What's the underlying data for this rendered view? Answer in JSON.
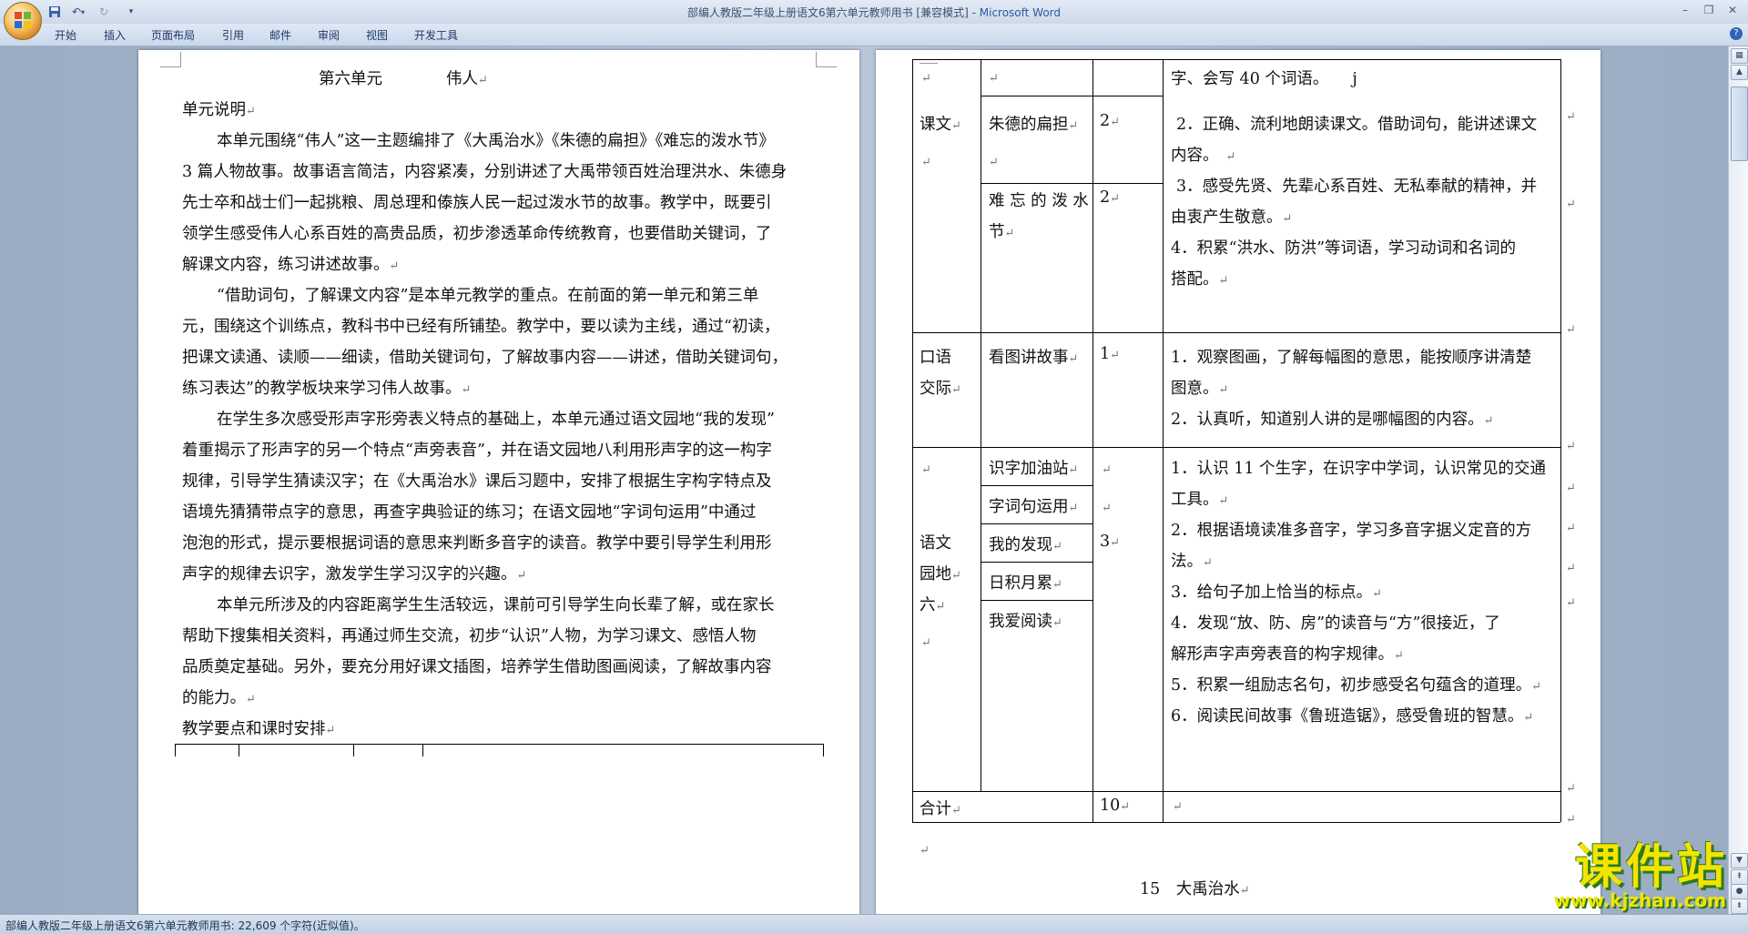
{
  "window": {
    "title_main": "部编人教版二年级上册语文6第六单元教师用书 [兼容模式] - ",
    "title_app": "Microsoft Word"
  },
  "ribbon": {
    "tabs": [
      "开始",
      "插入",
      "页面布局",
      "引用",
      "邮件",
      "审阅",
      "视图",
      "开发工具"
    ]
  },
  "left_page": {
    "heading_unit": "第六单元",
    "heading_theme": "伟人",
    "lines": [
      "单元说明",
      "本单元围绕“伟人”这一主题编排了《大禹治水》《朱德的扁担》《难忘的泼水节》",
      "3 篇人物故事。故事语言简洁，内容紧凑，分别讲述了大禹带领百姓治理洪水、朱德身",
      "先士卒和战士们一起挑粮、周总理和傣族人民一起过泼水节的故事。教学中，既要引",
      "领学生感受伟人心系百姓的高贵品质，初步渗透革命传统教育，也要借助关键词，了",
      "解课文内容，练习讲述故事。",
      "“借助词句，了解课文内容”是本单元教学的重点。在前面的第一单元和第三单",
      "元，围绕这个训练点，教科书中已经有所铺垫。教学中，要以读为主线，通过“初读，",
      "把课文读通、读顺——细读，借助关键词句，了解故事内容——讲述，借助关键词句，",
      "练习表达”的教学板块来学习伟人故事。",
      "在学生多次感受形声字形旁表义特点的基础上，本单元通过语文园地“我的发现”",
      "着重揭示了形声字的另一个特点“声旁表音”，并在语文园地八利用形声字的这一构字",
      "规律，引导学生猜读汉字；在《大禹治水》课后习题中，安排了根据生字构字特点及",
      "语境先猜猜带点字的意思，再查字典验证的练习；在语文园地“字词句运用”中通过",
      "泡泡的形式，提示要根据词语的意思来判断多音字的读音。教学中要引导学生利用形",
      "声字的规律去识字，激发学生学习汉字的兴趣。",
      "本单元所涉及的内容距离学生生活较远，课前可引导学生向长辈了解，或在家长",
      "帮助下搜集相关资料，再通过师生交流，初步“认识”人物，为学习课文、感悟人物",
      "品质奠定基础。另外，要充分用好课文插图，培养学生借助图画阅读，了解故事内容",
      "的能力。",
      "教学要点和课时安排"
    ]
  },
  "right_page": {
    "rows": {
      "kewen": {
        "category": "课文",
        "items": [
          {
            "name": "朱德的扁担",
            "hours": "2"
          },
          {
            "name_l1": "难 忘 的 泼 水",
            "name_l2": "节",
            "hours": "2"
          }
        ],
        "goals": [
          "字、会写 40 个词语。",
          "j",
          "2．正确、流利地朗读课文。借助词句，能讲述课文",
          "内容。",
          "3．感受先贤、先辈心系百姓、无私奉献的精神，并",
          "由衷产生敬意。",
          "4．积累“洪水、防洪”等词语，学习动词和名词的",
          "搭配。"
        ]
      },
      "kouyu": {
        "category_l1": "口语",
        "category_l2": "交际",
        "item": "看图讲故事",
        "hours": "1",
        "goals": [
          "1．观察图画，了解每幅图的意思，能按顺序讲清楚",
          "图意。",
          "2．认真听，知道别人讲的是哪幅图的内容。"
        ]
      },
      "yuanwen": {
        "category_l1": "语文",
        "category_l2": "园地",
        "category_l3": "六",
        "items": [
          "识字加油站",
          "字词句运用",
          "我的发现",
          "日积月累",
          "我爱阅读"
        ],
        "hours": "3",
        "goals": [
          "1．认识 11 个生字，在识字中学词，认识常见的交通",
          "工具。",
          "2．根据语境读准多音字，学习多音字据义定音的方",
          "法。",
          "3．给句子加上恰当的标点。",
          "4．发现“放、防、房”的读音与“方”很接近，了",
          "解形声字声旁表音的构字规律。",
          "5．积累一组励志名句，初步感受名句蕴含的道理。",
          "6．阅读民间故事《鲁班造锯》，感受鲁班的智慧。"
        ]
      },
      "total": {
        "label": "合计",
        "hours": "10"
      }
    },
    "next_lesson": "15　大禹治水"
  },
  "statusbar": {
    "text": "部编人教版二年级上册语文6第六单元教师用书: 22,609 个字符(近似值)。"
  },
  "watermark": {
    "main": "课件站",
    "url": "www.kjzhan.com"
  }
}
